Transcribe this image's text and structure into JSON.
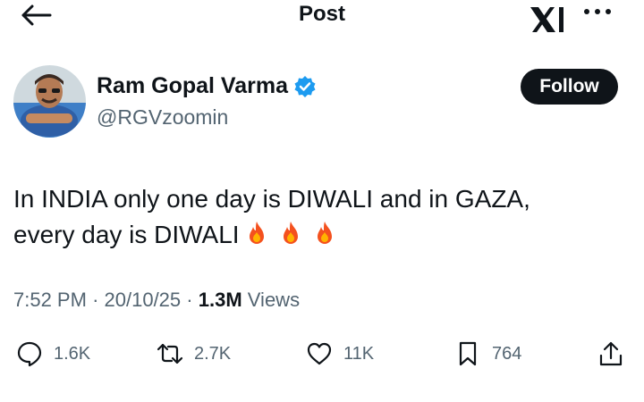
{
  "header": {
    "title": "Post"
  },
  "author": {
    "name": "Ram Gopal Varma",
    "handle": "@RGVzoomin",
    "follow_label": "Follow"
  },
  "post": {
    "text_line1": "In INDIA only one day is DIWALI and in GAZA,",
    "text_line2": "every day is DIWALI",
    "emoji": [
      "fire",
      "fire",
      "fire"
    ]
  },
  "meta": {
    "time": "7:52 PM",
    "date": "20/10/25",
    "views_count": "1.3M",
    "views_label": "Views"
  },
  "actions": {
    "replies": "1.6K",
    "reposts": "2.7K",
    "likes": "11K",
    "bookmarks": "764"
  },
  "colors": {
    "text": "#0f1419",
    "secondary": "#536471",
    "verified": "#1d9bf0"
  }
}
